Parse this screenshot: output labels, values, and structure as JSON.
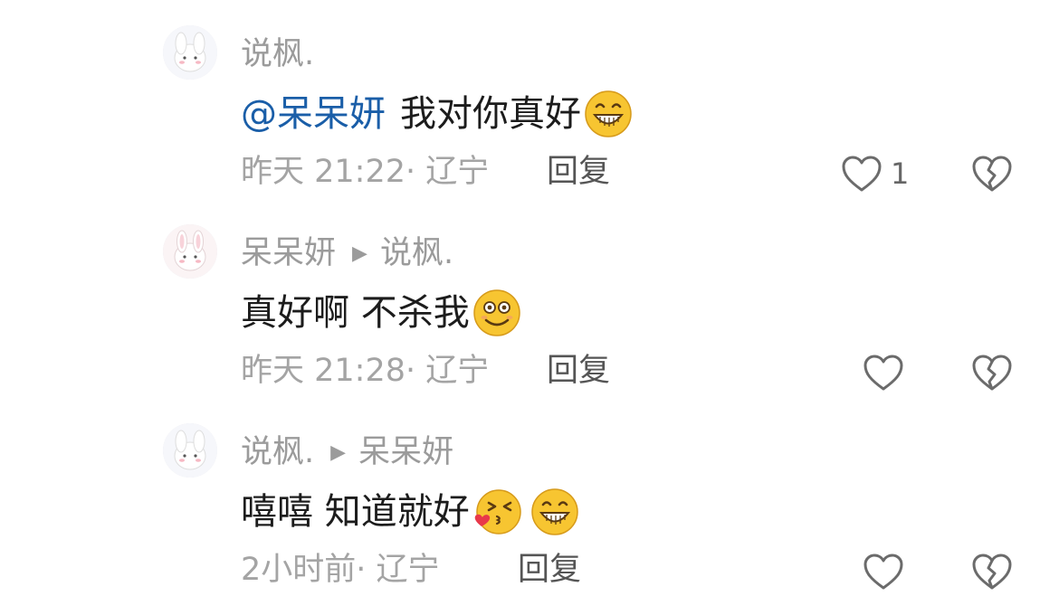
{
  "comments": [
    {
      "author": "说枫.",
      "reply_to": "",
      "mention": "@呆呆妍",
      "text": "我对你真好",
      "emojis": [
        "grin-emoji"
      ],
      "time": "昨天 21:22",
      "location": "· 辽宁",
      "reply_label": "回复",
      "likes": "1"
    },
    {
      "author": "呆呆妍",
      "reply_to": "说枫.",
      "mention": "",
      "text": "真好啊 不杀我",
      "emojis": [
        "smile-emoji"
      ],
      "time": "昨天 21:28",
      "location": "· 辽宁",
      "reply_label": "回复",
      "likes": ""
    },
    {
      "author": "说枫.",
      "reply_to": "呆呆妍",
      "mention": "",
      "text": "嘻嘻 知道就好",
      "emojis": [
        "kiss-heart-emoji",
        "grin-emoji"
      ],
      "time": "2小时前",
      "location": "· 辽宁",
      "reply_label": "回复",
      "likes": ""
    }
  ],
  "colors": {
    "mention": "#1a5ea8",
    "text": "#1c1c1c",
    "meta": "#a4a4a4",
    "emoji_yellow": "#f7c531"
  }
}
